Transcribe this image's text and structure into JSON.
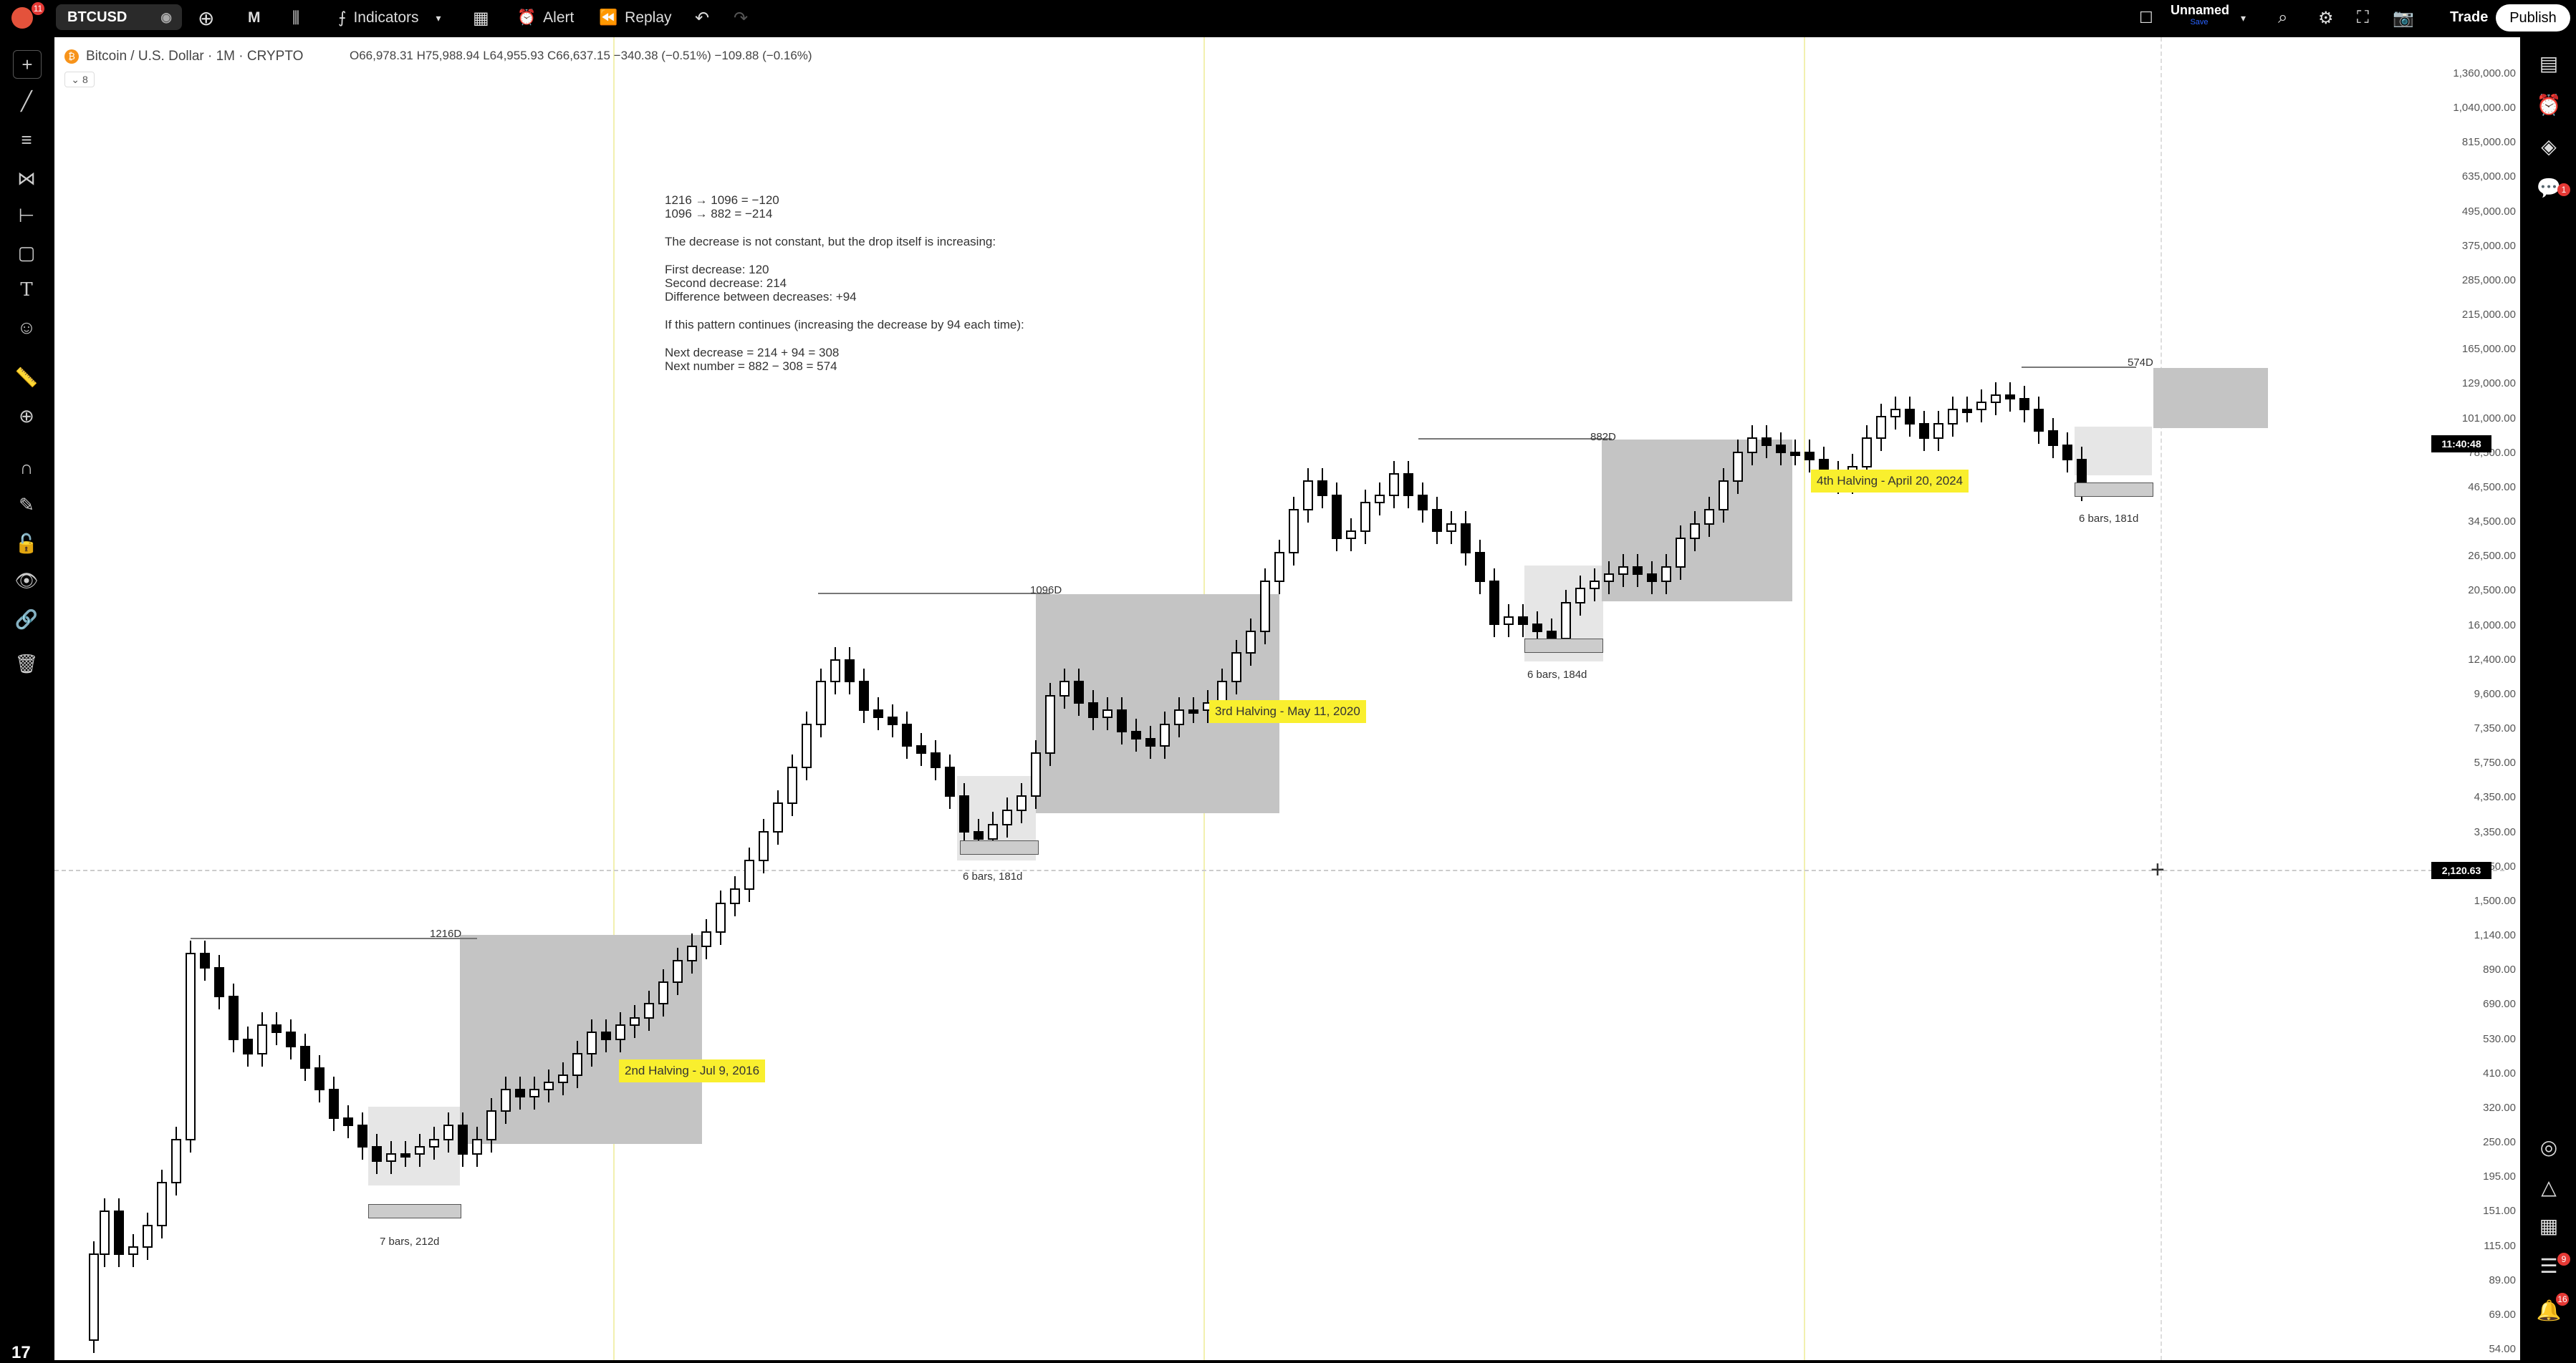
{
  "toolbar": {
    "logo_badge": "11",
    "symbol": "BTCUSD",
    "interval": "M",
    "indicators": "Indicators",
    "alert": "Alert",
    "replay": "Replay",
    "layout_name": "Unnamed",
    "layout_status": "Save",
    "trade": "Trade",
    "publish": "Publish"
  },
  "legend": {
    "title": "Bitcoin / U.S. Dollar · 1M · CRYPTO",
    "ohlc": "O66,978.31 H75,988.94 L64,955.93 C66,637.15 −340.38 (−0.51%) −109.88 (−0.16%)",
    "collapsed_count": "8"
  },
  "note": {
    "lines": [
      "1216 → 1096 = −120",
      "1096 → 882 = −214",
      "",
      "The decrease is not constant, but the drop itself is increasing:",
      "",
      "First decrease: 120",
      "Second decrease: 214",
      "Difference between decreases: +94",
      "",
      "If this pattern continues (increasing the decrease by 94 each time):",
      "",
      "Next decrease = 214 + 94 = 308",
      "Next number = 882 − 308 = 574"
    ]
  },
  "annotations": {
    "halvings": [
      "2nd Halving - Jul 9, 2016",
      "3rd Halving - May 11, 2020",
      "4th Halving - April 20, 2024"
    ],
    "ranges": [
      "1216D",
      "1096D",
      "882D",
      "574D"
    ],
    "bars": [
      "7 bars, 212d",
      "6 bars, 181d",
      "6 bars, 184d",
      "6 bars, 181d"
    ]
  },
  "price_scale": [
    "1,360,000.00",
    "1,040,000.00",
    "815,000.00",
    "635,000.00",
    "495,000.00",
    "375,000.00",
    "285,000.00",
    "215,000.00",
    "165,000.00",
    "129,000.00",
    "101,000.00",
    "78,500.00",
    "46,500.00",
    "34,500.00",
    "26,500.00",
    "20,500.00",
    "16,000.00",
    "12,400.00",
    "9,600.00",
    "7,350.00",
    "5,750.00",
    "4,350.00",
    "3,350.00",
    "2,550.00",
    "1,500.00",
    "1,140.00",
    "890.00",
    "690.00",
    "530.00",
    "410.00",
    "320.00",
    "250.00",
    "195.00",
    "151.00",
    "115.00",
    "89.00",
    "69.00",
    "54.00"
  ],
  "countdown": "11:40:48",
  "crosshair_price": "2,120.63",
  "right_badges": {
    "chat": "1",
    "ideas": "9",
    "notifications": "16"
  },
  "colors": {
    "halving": "#f9ef2e",
    "box_dark": "#c4c4c4",
    "box_light": "#e6e6e6",
    "halving_line": "#f2f0b0"
  }
}
